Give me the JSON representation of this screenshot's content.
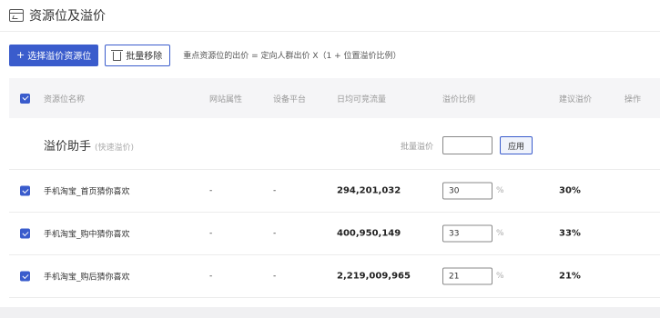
{
  "header": {
    "title": "资源位及溢价"
  },
  "toolbar": {
    "add_label": "选择溢价资源位",
    "remove_label": "批量移除",
    "formula": "重点资源位的出价 = 定向人群出价 X（1 + 位置溢价比例）"
  },
  "table": {
    "columns": {
      "name": "资源位名称",
      "site": "网站属性",
      "device": "设备平台",
      "traffic": "日均可竞流量",
      "ratio": "溢价比例",
      "suggest": "建议溢价",
      "op": "操作"
    },
    "helper": {
      "title": "溢价助手",
      "subtitle": "(快速溢价)",
      "batch_label": "批量溢价",
      "batch_value": "",
      "apply_label": "应用"
    },
    "rows": [
      {
        "name": "手机淘宝_首页猜你喜欢",
        "site": "-",
        "device": "-",
        "traffic": "294,201,032",
        "ratio": "30",
        "unit": "%",
        "suggest": "30%"
      },
      {
        "name": "手机淘宝_购中猜你喜欢",
        "site": "-",
        "device": "-",
        "traffic": "400,950,149",
        "ratio": "33",
        "unit": "%",
        "suggest": "33%"
      },
      {
        "name": "手机淘宝_购后猜你喜欢",
        "site": "-",
        "device": "-",
        "traffic": "2,219,009,965",
        "ratio": "21",
        "unit": "%",
        "suggest": "21%"
      }
    ]
  }
}
